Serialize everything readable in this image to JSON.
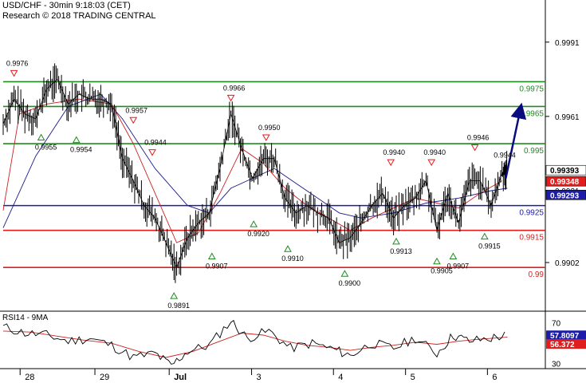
{
  "header": {
    "instrument_line": "USD/CHF - 30min 9:18:03 (CET)",
    "research_line": "Research © 2018 TRADING CENTRAL"
  },
  "rsi_panel": {
    "label": "RSI14 - 9MA"
  },
  "colors": {
    "resistance": "#1e8c1e",
    "support": "#e01e1e",
    "pivot": "#1c1ca8",
    "price": "#000000",
    "ma_fast": "#cc2222",
    "ma_slow": "#1a1a8c",
    "arrow": "#0b0b80"
  },
  "chart_data": {
    "type": "line",
    "title": "USD/CHF - 30min",
    "x_axis": {
      "tick_labels": [
        "28",
        "29",
        "Jul",
        "3",
        "4",
        "5",
        "6"
      ]
    },
    "y_axis": {
      "tick_labels": [
        0.9991,
        0.9961,
        0.9931,
        0.9902
      ],
      "range": [
        0.9883,
        1.0008
      ]
    },
    "current_prices": [
      {
        "label": "0.99393",
        "value": 0.99393,
        "style": "white"
      },
      {
        "label": "0.99348",
        "value": 0.99348,
        "style": "red"
      },
      {
        "label": "0.99293",
        "value": 0.99293,
        "style": "blue"
      }
    ],
    "key_levels": [
      {
        "value": 0.9975,
        "label": "0.9975",
        "kind": "resistance"
      },
      {
        "value": 0.9965,
        "label": "0.9965",
        "kind": "resistance"
      },
      {
        "value": 0.995,
        "label": "0.995",
        "kind": "resistance"
      },
      {
        "value": 0.9925,
        "label": "0.9925",
        "kind": "pivot"
      },
      {
        "value": 0.9915,
        "label": "0.9915",
        "kind": "support"
      },
      {
        "value": 0.99,
        "label": "0.99",
        "kind": "support"
      }
    ],
    "annotations": [
      {
        "label": "0.9976",
        "value": 0.9976,
        "t": 0.02,
        "type": "high"
      },
      {
        "label": "0.9955",
        "value": 0.9955,
        "t": 0.07,
        "type": "low"
      },
      {
        "label": "0.9954",
        "value": 0.9954,
        "t": 0.135,
        "type": "low"
      },
      {
        "label": "0.9957",
        "value": 0.9957,
        "t": 0.24,
        "type": "high"
      },
      {
        "label": "0.9944",
        "value": 0.9944,
        "t": 0.275,
        "type": "high"
      },
      {
        "label": "0.9891",
        "value": 0.9891,
        "t": 0.315,
        "type": "low"
      },
      {
        "label": "0.9907",
        "value": 0.9907,
        "t": 0.385,
        "type": "low"
      },
      {
        "label": "0.9966",
        "value": 0.9966,
        "t": 0.42,
        "type": "high"
      },
      {
        "label": "0.9920",
        "value": 0.992,
        "t": 0.462,
        "type": "low"
      },
      {
        "label": "0.9950",
        "value": 0.995,
        "t": 0.485,
        "type": "high"
      },
      {
        "label": "0.9910",
        "value": 0.991,
        "t": 0.525,
        "type": "low"
      },
      {
        "label": "0.9900",
        "value": 0.99,
        "t": 0.63,
        "type": "low"
      },
      {
        "label": "0.9940",
        "value": 0.994,
        "t": 0.715,
        "type": "high"
      },
      {
        "label": "0.9913",
        "value": 0.9913,
        "t": 0.725,
        "type": "low"
      },
      {
        "label": "0.9940",
        "value": 0.994,
        "t": 0.79,
        "type": "high"
      },
      {
        "label": "0.9905",
        "value": 0.9905,
        "t": 0.8,
        "type": "low"
      },
      {
        "label": "0.9907",
        "value": 0.9907,
        "t": 0.83,
        "type": "low"
      },
      {
        "label": "0.9946",
        "value": 0.9946,
        "t": 0.87,
        "type": "high"
      },
      {
        "label": "0.9915",
        "value": 0.9915,
        "t": 0.888,
        "type": "low"
      },
      {
        "label": "0.9944",
        "value": 0.9944,
        "t": 0.925,
        "type": "text"
      }
    ],
    "price_path": [
      [
        0.0,
        0.9958
      ],
      [
        0.02,
        0.9968
      ],
      [
        0.04,
        0.9962
      ],
      [
        0.06,
        0.996
      ],
      [
        0.08,
        0.9972
      ],
      [
        0.1,
        0.9976
      ],
      [
        0.12,
        0.9966
      ],
      [
        0.14,
        0.997
      ],
      [
        0.16,
        0.9968
      ],
      [
        0.18,
        0.9968
      ],
      [
        0.2,
        0.9966
      ],
      [
        0.22,
        0.9944
      ],
      [
        0.24,
        0.9935
      ],
      [
        0.26,
        0.9925
      ],
      [
        0.28,
        0.992
      ],
      [
        0.3,
        0.991
      ],
      [
        0.32,
        0.99
      ],
      [
        0.34,
        0.9912
      ],
      [
        0.36,
        0.9918
      ],
      [
        0.38,
        0.9922
      ],
      [
        0.4,
        0.994
      ],
      [
        0.42,
        0.9962
      ],
      [
        0.44,
        0.9948
      ],
      [
        0.46,
        0.9936
      ],
      [
        0.48,
        0.9944
      ],
      [
        0.5,
        0.9944
      ],
      [
        0.52,
        0.9928
      ],
      [
        0.54,
        0.9922
      ],
      [
        0.56,
        0.9925
      ],
      [
        0.58,
        0.9922
      ],
      [
        0.6,
        0.992
      ],
      [
        0.62,
        0.991
      ],
      [
        0.64,
        0.9912
      ],
      [
        0.66,
        0.9918
      ],
      [
        0.68,
        0.9925
      ],
      [
        0.7,
        0.993
      ],
      [
        0.72,
        0.992
      ],
      [
        0.74,
        0.9925
      ],
      [
        0.76,
        0.9928
      ],
      [
        0.78,
        0.9935
      ],
      [
        0.8,
        0.9915
      ],
      [
        0.82,
        0.993
      ],
      [
        0.84,
        0.9918
      ],
      [
        0.86,
        0.9935
      ],
      [
        0.88,
        0.9935
      ],
      [
        0.9,
        0.9925
      ],
      [
        0.92,
        0.9938
      ],
      [
        0.93,
        0.994
      ]
    ],
    "ma_fast_path": [
      [
        0.0,
        0.9923
      ],
      [
        0.03,
        0.9962
      ],
      [
        0.08,
        0.9966
      ],
      [
        0.14,
        0.9968
      ],
      [
        0.2,
        0.9966
      ],
      [
        0.24,
        0.995
      ],
      [
        0.28,
        0.993
      ],
      [
        0.32,
        0.991
      ],
      [
        0.36,
        0.9914
      ],
      [
        0.4,
        0.993
      ],
      [
        0.44,
        0.9948
      ],
      [
        0.48,
        0.9942
      ],
      [
        0.52,
        0.9932
      ],
      [
        0.56,
        0.9925
      ],
      [
        0.6,
        0.992
      ],
      [
        0.64,
        0.9915
      ],
      [
        0.68,
        0.992
      ],
      [
        0.72,
        0.9924
      ],
      [
        0.76,
        0.9928
      ],
      [
        0.8,
        0.9926
      ],
      [
        0.84,
        0.9924
      ],
      [
        0.88,
        0.993
      ],
      [
        0.92,
        0.9935
      ]
    ],
    "ma_slow_path": [
      [
        0.0,
        0.9916
      ],
      [
        0.06,
        0.9945
      ],
      [
        0.12,
        0.9965
      ],
      [
        0.18,
        0.997
      ],
      [
        0.22,
        0.996
      ],
      [
        0.28,
        0.994
      ],
      [
        0.34,
        0.9925
      ],
      [
        0.38,
        0.9922
      ],
      [
        0.42,
        0.9932
      ],
      [
        0.46,
        0.9936
      ],
      [
        0.5,
        0.994
      ],
      [
        0.54,
        0.9934
      ],
      [
        0.58,
        0.9928
      ],
      [
        0.62,
        0.9922
      ],
      [
        0.66,
        0.992
      ],
      [
        0.72,
        0.9922
      ],
      [
        0.78,
        0.9926
      ],
      [
        0.84,
        0.9928
      ],
      [
        0.9,
        0.9931
      ],
      [
        0.93,
        0.9932
      ]
    ],
    "forecast_arrow": {
      "from": [
        0.927,
        0.9936
      ],
      "to": [
        0.955,
        0.9965
      ]
    },
    "rsi": {
      "label": "RSI14 - 9MA",
      "y_ticks": [
        70,
        30
      ],
      "values": [
        {
          "label": "57.8097",
          "value": 57.8097,
          "style": "blue"
        },
        {
          "label": "56.372",
          "value": 56.372,
          "style": "red"
        }
      ],
      "rsi_path": [
        [
          0.0,
          66
        ],
        [
          0.04,
          60
        ],
        [
          0.08,
          58
        ],
        [
          0.12,
          52
        ],
        [
          0.16,
          55
        ],
        [
          0.2,
          48
        ],
        [
          0.24,
          36
        ],
        [
          0.28,
          40
        ],
        [
          0.31,
          28
        ],
        [
          0.34,
          42
        ],
        [
          0.38,
          48
        ],
        [
          0.42,
          72
        ],
        [
          0.45,
          55
        ],
        [
          0.49,
          62
        ],
        [
          0.53,
          45
        ],
        [
          0.57,
          50
        ],
        [
          0.61,
          44
        ],
        [
          0.64,
          38
        ],
        [
          0.68,
          50
        ],
        [
          0.72,
          45
        ],
        [
          0.76,
          55
        ],
        [
          0.8,
          40
        ],
        [
          0.83,
          58
        ],
        [
          0.86,
          52
        ],
        [
          0.9,
          55
        ],
        [
          0.93,
          58
        ]
      ],
      "ma_path": [
        [
          0.0,
          62
        ],
        [
          0.05,
          61
        ],
        [
          0.1,
          57
        ],
        [
          0.15,
          53
        ],
        [
          0.2,
          50
        ],
        [
          0.25,
          42
        ],
        [
          0.3,
          36
        ],
        [
          0.35,
          42
        ],
        [
          0.4,
          52
        ],
        [
          0.44,
          60
        ],
        [
          0.48,
          58
        ],
        [
          0.52,
          52
        ],
        [
          0.56,
          48
        ],
        [
          0.6,
          46
        ],
        [
          0.64,
          43
        ],
        [
          0.68,
          46
        ],
        [
          0.72,
          48
        ],
        [
          0.76,
          51
        ],
        [
          0.8,
          49
        ],
        [
          0.84,
          52
        ],
        [
          0.88,
          54
        ],
        [
          0.93,
          56
        ]
      ]
    }
  }
}
